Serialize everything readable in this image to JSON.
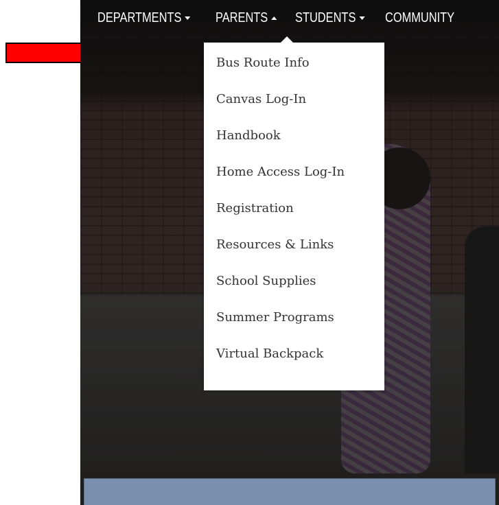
{
  "nav": {
    "items": [
      {
        "label": "DEPARTMENTS",
        "caret": "down"
      },
      {
        "label": "PARENTS",
        "caret": "up"
      },
      {
        "label": "STUDENTS",
        "caret": "down"
      },
      {
        "label": "COMMUNITY",
        "caret": "none"
      }
    ]
  },
  "parents_menu": {
    "items": [
      "Bus Route Info",
      "Canvas Log-In",
      "Handbook",
      "Home Access Log-In",
      "Registration",
      "Resources & Links",
      "School Supplies",
      "Summer Programs",
      "Virtual Backpack"
    ]
  },
  "colors": {
    "marker": "#ff0000",
    "panel": "#7a8fad",
    "nav_text": "#ffffff",
    "menu_text": "#333333"
  },
  "icons": {
    "caret_down": "chevron-down-icon",
    "caret_up": "chevron-up-icon"
  }
}
